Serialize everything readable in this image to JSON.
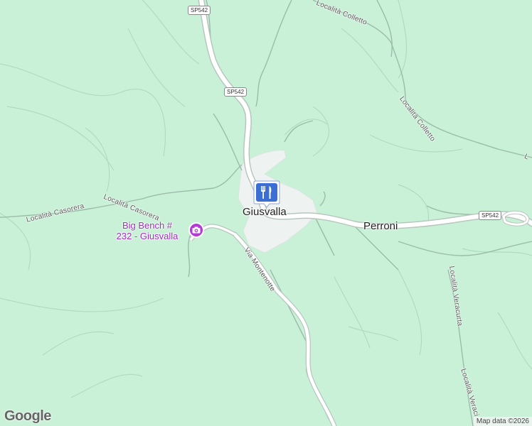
{
  "map": {
    "place_labels": {
      "giusvalla": "Giusvalla",
      "perroni": "Perroni"
    },
    "road_labels": {
      "localita_colletto_top": "Località Colletto",
      "localita_colletto_right": "Località Colletto",
      "localita_casorera_left": "Località Casorera",
      "localita_casorera_mid": "Località Casorera",
      "via_montenotte": "Via Montenotte",
      "localita_veracurta_1": "Località Veracurta",
      "localita_veracurta_2": "Località Veraci",
      "edge_fragment": "L"
    },
    "shields": {
      "sp542_top": "SP542",
      "sp542_mid": "SP542",
      "sp542_right": "SP542"
    },
    "poi": {
      "big_bench_label": "Big Bench # 232 - Giusvalla",
      "big_bench_line1": "Big Bench #",
      "big_bench_line2": "232 - Giusvalla",
      "poi_icon": "camera-icon",
      "restaurant_icon": "restaurant-icon"
    },
    "colors": {
      "land": "#c9f1d7",
      "road_main": "#ffffff",
      "road_outline": "#b8c8c0",
      "town_area": "#eef3f1",
      "poi_purple": "#b33ad6",
      "restaurant_blue": "#3b6fd4"
    },
    "branding": {
      "logo": "Google",
      "attribution": "Map data ©2026"
    }
  }
}
